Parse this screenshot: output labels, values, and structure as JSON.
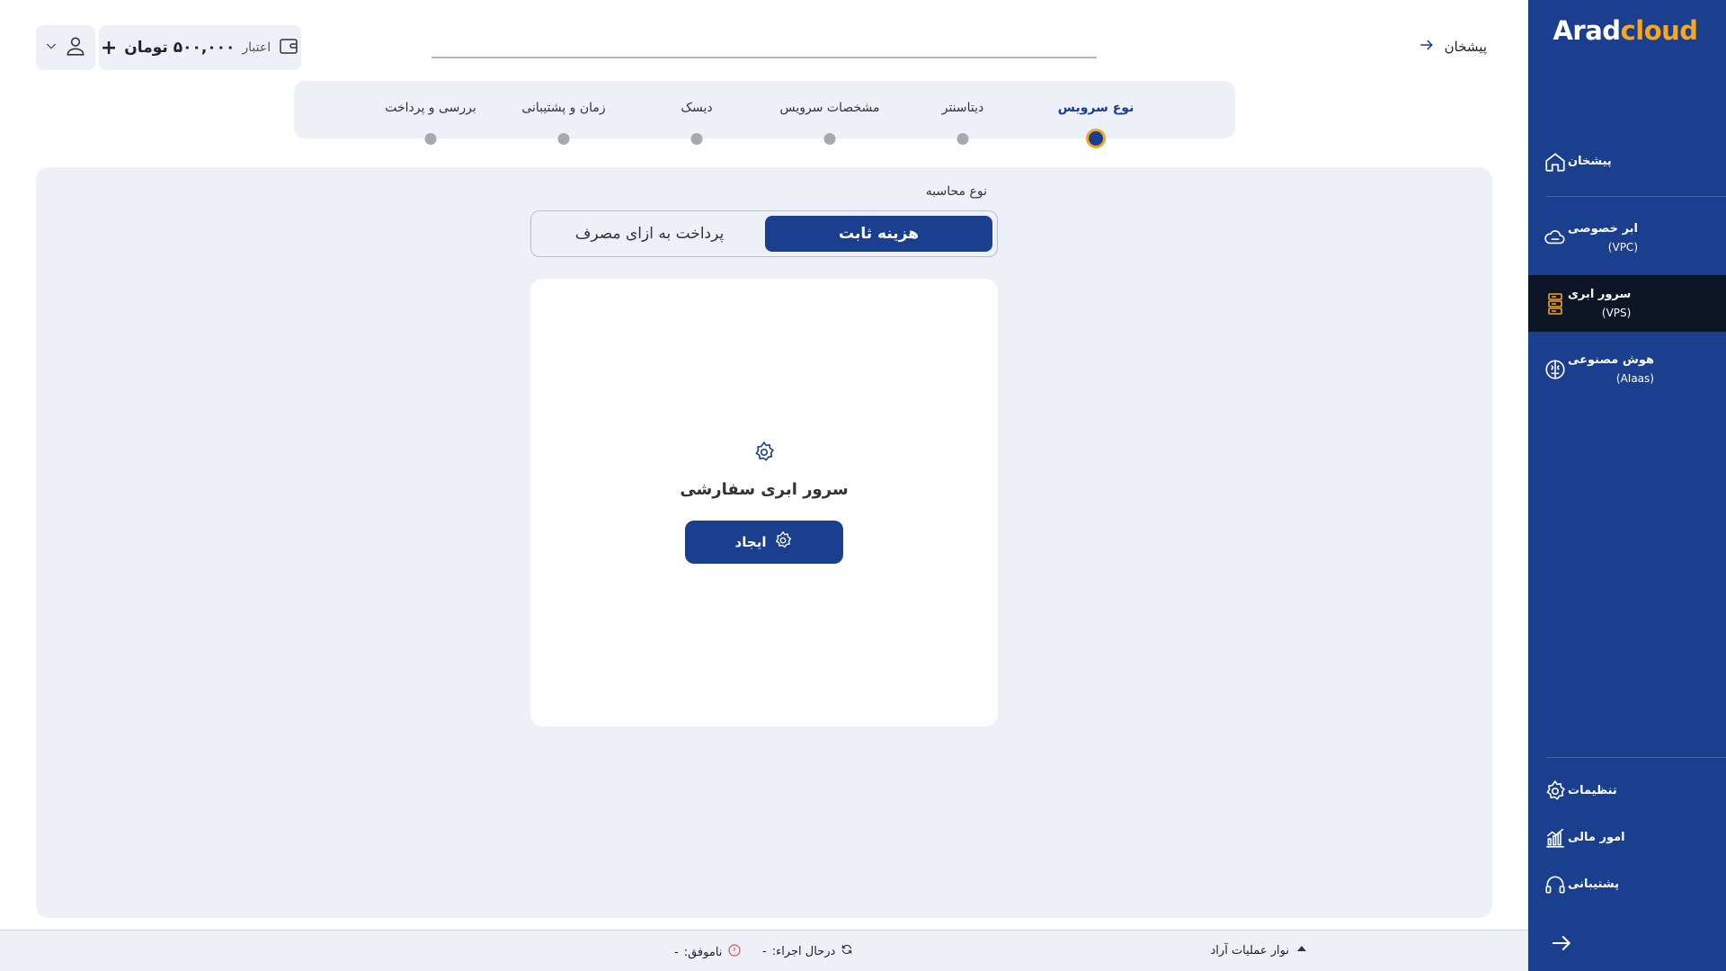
{
  "brand": {
    "logo_part1": "Arad",
    "logo_part2": "cloud"
  },
  "sidebar": {
    "items": [
      {
        "label": "پیشخان",
        "sub": "",
        "icon": "home-icon"
      },
      {
        "label": "ابر خصوصی",
        "sub": "(VPC)",
        "icon": "cloud-icon"
      },
      {
        "label": "سرور ابری",
        "sub": "(VPS)",
        "icon": "server-icon"
      },
      {
        "label": "هوش مصنوعی",
        "sub": "(AIaas)",
        "icon": "brain-icon"
      }
    ],
    "bottom_items": [
      {
        "label": "تنظیمات",
        "icon": "gear-icon"
      },
      {
        "label": "امور مالی",
        "icon": "chart-icon"
      },
      {
        "label": "پشتیبانی",
        "icon": "headset-icon"
      }
    ]
  },
  "header": {
    "back_label": "پیشخان",
    "credit_label": "اعتبار",
    "credit_amount": "۵۰۰,۰۰۰ تومان"
  },
  "stepper": {
    "steps": [
      "نوع سرویس",
      "دیتاسنتر",
      "مشخصات سرویس",
      "دیسک",
      "زمان و پشتیبانی",
      "بررسی و پرداخت"
    ],
    "active_index": 0
  },
  "main": {
    "calc_label": "نوع محاسبه",
    "toggle_on": "هزینه ثابت",
    "toggle_off": "پرداخت به ازای مصرف",
    "card_title": "سرور ابری سفارشی",
    "create_label": "ایجاد"
  },
  "statusbar": {
    "title": "نوار عملیات آراد",
    "running_label": "درحال اجراء:",
    "running_value": "-",
    "failed_label": "ناموفق:",
    "failed_value": "-"
  },
  "colors": {
    "primary": "#1a3f8f",
    "accent": "#f5a623",
    "panel": "#edf1f7"
  }
}
